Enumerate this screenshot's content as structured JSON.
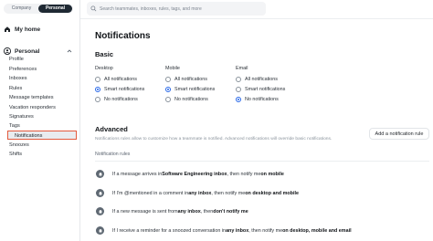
{
  "sidebar": {
    "toggle": {
      "company": "Company",
      "personal": "Personal"
    },
    "my_home": "My home",
    "personal": "Personal",
    "items": [
      {
        "label": "Profile"
      },
      {
        "label": "Preferences"
      },
      {
        "label": "Inboxes"
      },
      {
        "label": "Rules"
      },
      {
        "label": "Message templates"
      },
      {
        "label": "Vacation responders"
      },
      {
        "label": "Signatures"
      },
      {
        "label": "Tags"
      },
      {
        "label": "Notifications",
        "selected": true
      },
      {
        "label": "Snoozes"
      },
      {
        "label": "Shifts"
      }
    ]
  },
  "search": {
    "placeholder": "Search teammates, inboxes, rules, tags, and more"
  },
  "main": {
    "title": "Notifications",
    "basic": {
      "title": "Basic",
      "columns": [
        {
          "label": "Desktop",
          "options": [
            "All notifications",
            "Smart notifications",
            "No notifications"
          ],
          "selected": 1
        },
        {
          "label": "Mobile",
          "options": [
            "All notifications",
            "Smart notifications",
            "No notifications"
          ],
          "selected": 1
        },
        {
          "label": "Email",
          "options": [
            "All notifications",
            "Smart notifications",
            "No notifications"
          ],
          "selected": 2
        }
      ]
    },
    "advanced": {
      "title": "Advanced",
      "description": "Notifications rules allow to customize how a teammate is notified. Advanced notifications will override basic notifications.",
      "add_button": "Add a notification rule",
      "rules_label": "Notification rules",
      "rules": [
        {
          "p1": "If a message arrives in ",
          "b1": "Software Engineering inbox",
          "p2": ", then notify me ",
          "b2": "on mobile"
        },
        {
          "p1": "If I'm @mentioned in a comment in ",
          "b1": "any inbox",
          "p2": ", then notify me ",
          "b2": "on desktop and mobile"
        },
        {
          "p1": "If a new message is sent from ",
          "b1": "any inbox",
          "p2": ", then ",
          "b2": "don't notify me"
        },
        {
          "p1": "If I receive a reminder for a snoozed conversation in ",
          "b1": "any inbox",
          "p2": ", then notify me ",
          "b2": "on desktop, mobile and email"
        }
      ]
    }
  },
  "colors": {
    "accent": "#2566e8",
    "selected_outline": "#e35a3d",
    "dark": "#1f2933"
  }
}
